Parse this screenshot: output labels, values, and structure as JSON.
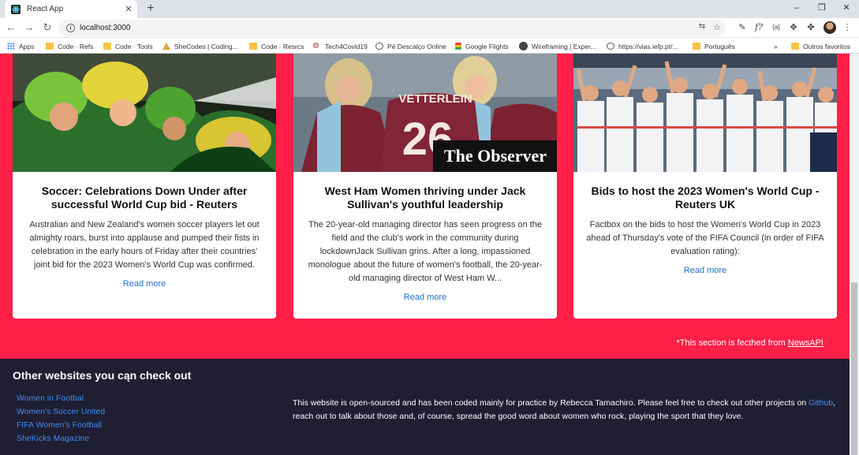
{
  "browser": {
    "tab_title": "React App",
    "url": "localhost:3000",
    "bookmarks": [
      {
        "label": "Apps",
        "icon": "apps-grid-icon"
      },
      {
        "label": "Code · Refs",
        "icon": "folder-icon"
      },
      {
        "label": "Code · Tools",
        "icon": "folder-icon"
      },
      {
        "label": "SheCodes | Coding...",
        "icon": "shecodes-icon"
      },
      {
        "label": "Code · Resrcs",
        "icon": "folder-icon"
      },
      {
        "label": "Tech4Covid19",
        "icon": "gear-icon"
      },
      {
        "label": "Pé Descalço Online",
        "icon": "globe-icon"
      },
      {
        "label": "Google Flights",
        "icon": "google-flights-icon"
      },
      {
        "label": "Wireframing | Exper...",
        "icon": "wireframing-icon"
      },
      {
        "label": "https://vias.iefp.pt/...",
        "icon": "globe-icon"
      },
      {
        "label": "Português",
        "icon": "folder-icon"
      }
    ],
    "bookmarks_more": "»",
    "other_bookmarks": "Outros favoritos"
  },
  "news": {
    "cards": [
      {
        "title": "Soccer: Celebrations Down Under after successful World Cup bid - Reuters",
        "description": "Australian and New Zealand's women soccer players let out almighty roars, burst into applause and pumped their fists in celebration in the early hours of Friday after their countries' joint bid for the 2023 Women's World Cup was confirmed.",
        "link": "Read more"
      },
      {
        "title": "West Ham Women thriving under Jack Sullivan's youthful leadership",
        "description": "The 20-year-old managing director has seen progress on the field and the club's work in the community during lockdownJack Sullivan grins. After a long, impassioned monologue about the future of women's football, the 20-year-old managing director of West Ham W...",
        "link": "Read more",
        "image_overlay": "The Observer",
        "jersey_name": "VETTERLEIN",
        "jersey_number": "26"
      },
      {
        "title": "Bids to host the 2023 Women's World Cup - Reuters UK",
        "description": "Factbox on the bids to host the Women's World Cup in 2023 ahead of Thursday's vote of the FIFA Council (in order of FIFA evaluation rating):",
        "link": "Read more"
      }
    ],
    "fetched_prefix": "*This section is fecthed from ",
    "fetched_link": "NewsAPI"
  },
  "footer": {
    "heading": "Other websites you cąn check out",
    "links": [
      "Women in Footbal",
      "Women's Soccer United",
      "FIFA Women's Football",
      "SheKicks Magazine"
    ],
    "text_before": "This website is open-sourced and has been coded mainly for practice by Rebecca Tamachiro. Please feel free to check out other projects on ",
    "text_link": "Github",
    "text_after": ", reach out to talk about those and, of course, spread the good word about women who rock, playing the sport that they love."
  },
  "colors": {
    "news_background": "#ff1f47",
    "footer_background": "#1f1e33",
    "link": "#1f6fd0"
  }
}
